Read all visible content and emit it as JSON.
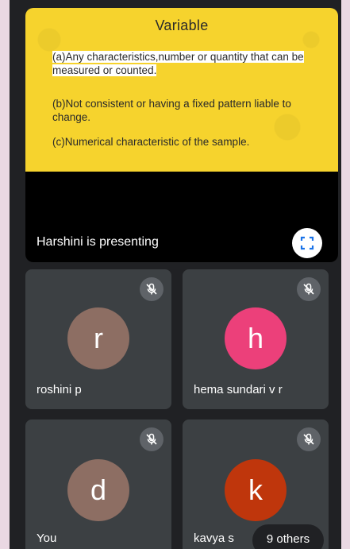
{
  "presentation": {
    "slide": {
      "title": "Variable",
      "items": [
        "(a)Any characteristics,number or quantity that can be measured or counted.",
        "(b)Not consistent or having a fixed pattern liable to change.",
        "(c)Numerical characteristic of the sample."
      ],
      "background_color": "#f6d32d"
    },
    "presenter_label": "Harshini is presenting",
    "fullscreen_icon": "fullscreen-icon"
  },
  "participants": [
    {
      "initial": "r",
      "name": "roshini p",
      "avatar_color": "#8d6e63",
      "muted": true
    },
    {
      "initial": "h",
      "name": "hema sundari v r",
      "avatar_color": "#ec407a",
      "muted": true
    },
    {
      "initial": "d",
      "name": "You",
      "avatar_color": "#8d6e63",
      "muted": true
    },
    {
      "initial": "k",
      "name": "kavya s",
      "avatar_color": "#bf360c",
      "muted": true
    }
  ],
  "others_label": "9 others"
}
